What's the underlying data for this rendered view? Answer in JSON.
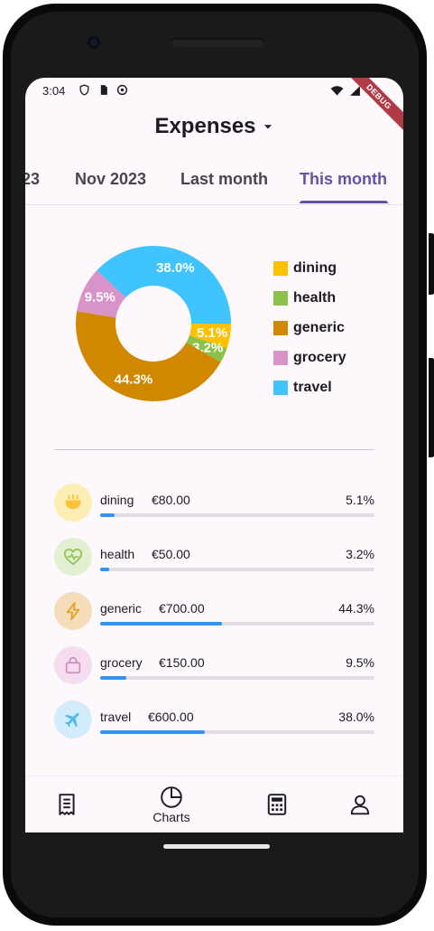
{
  "status": {
    "time": "3:04",
    "debug_label": "DEBUG"
  },
  "header": {
    "title": "Expenses"
  },
  "tabs": [
    {
      "label": "23",
      "active": false
    },
    {
      "label": "Nov 2023",
      "active": false
    },
    {
      "label": "Last month",
      "active": false
    },
    {
      "label": "This month",
      "active": true
    }
  ],
  "colors": {
    "accent": "#6750a4",
    "bar": "#2f95f0"
  },
  "chart_data": {
    "type": "pie",
    "style": "donut",
    "categories": [
      "dining",
      "health",
      "generic",
      "grocery",
      "travel"
    ],
    "values": [
      5.1,
      3.2,
      44.3,
      9.5,
      38.0
    ],
    "labels": [
      "5.1%",
      "3.2%",
      "44.3%",
      "9.5%",
      "38.0%"
    ],
    "colors": [
      "#fdc100",
      "#8bc34a",
      "#d08800",
      "#d893c8",
      "#40c4ff"
    ],
    "legend_placement": "right"
  },
  "categories": [
    {
      "name": "dining",
      "amount": "€80.00",
      "percent": "5.1%",
      "fraction": 0.051,
      "icon": "restaurant-icon",
      "bg": "#fdeeb4",
      "fg": "#fbc02d"
    },
    {
      "name": "health",
      "amount": "€50.00",
      "percent": "3.2%",
      "fraction": 0.032,
      "icon": "heart-pulse-icon",
      "bg": "#e3efd3",
      "fg": "#8bc34a"
    },
    {
      "name": "generic",
      "amount": "€700.00",
      "percent": "44.3%",
      "fraction": 0.443,
      "icon": "lightning-icon",
      "bg": "#f4ddb8",
      "fg": "#e6a020"
    },
    {
      "name": "grocery",
      "amount": "€150.00",
      "percent": "9.5%",
      "fraction": 0.095,
      "icon": "shopping-bag-icon",
      "bg": "#f6dcef",
      "fg": "#cf8ac0"
    },
    {
      "name": "travel",
      "amount": "€600.00",
      "percent": "38.0%",
      "fraction": 0.38,
      "icon": "airplane-icon",
      "bg": "#d3ecfb",
      "fg": "#4fb8ee"
    }
  ],
  "nav": [
    {
      "icon": "receipt-icon",
      "label": ""
    },
    {
      "icon": "pie-chart-icon",
      "label": "Charts"
    },
    {
      "icon": "calculator-icon",
      "label": ""
    },
    {
      "icon": "person-icon",
      "label": ""
    }
  ]
}
